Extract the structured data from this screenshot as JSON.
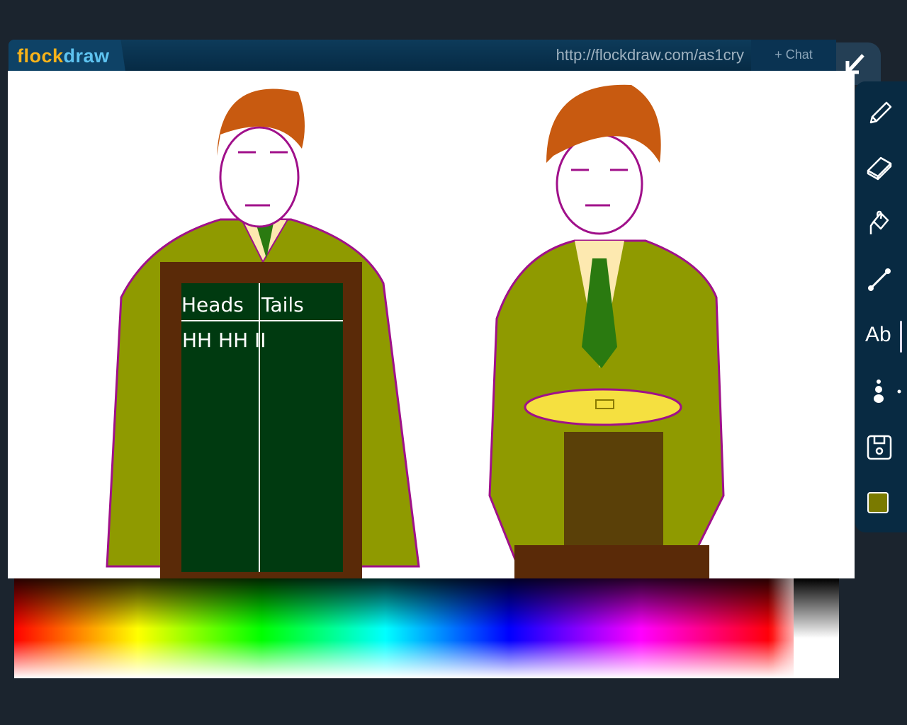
{
  "header": {
    "logo_part1": "flock",
    "logo_part2": "draw",
    "url": "http://flockdraw.com/as1cry",
    "chat_label": "+ Chat"
  },
  "toolbar": {
    "tools": [
      {
        "name": "pencil",
        "icon": "pencil-icon"
      },
      {
        "name": "eraser",
        "icon": "eraser-icon"
      },
      {
        "name": "fill",
        "icon": "paint-bucket-icon"
      },
      {
        "name": "line",
        "icon": "line-icon"
      },
      {
        "name": "text",
        "icon": "text-icon",
        "label": "Ab"
      },
      {
        "name": "brush-size",
        "icon": "brush-size-icon"
      },
      {
        "name": "save",
        "icon": "save-icon"
      },
      {
        "name": "color",
        "icon": "color-swatch-icon"
      }
    ],
    "current_color": "#7a7a00"
  },
  "drawing": {
    "board_heading_left": "Heads",
    "board_heading_right": "Tails",
    "tally": "HH HH II"
  },
  "colors": {
    "background": "#1b242e",
    "header": "#0b3350",
    "toolbar": "#082a42",
    "logo_orange": "#f7b21a",
    "logo_blue": "#5ec3f0"
  }
}
